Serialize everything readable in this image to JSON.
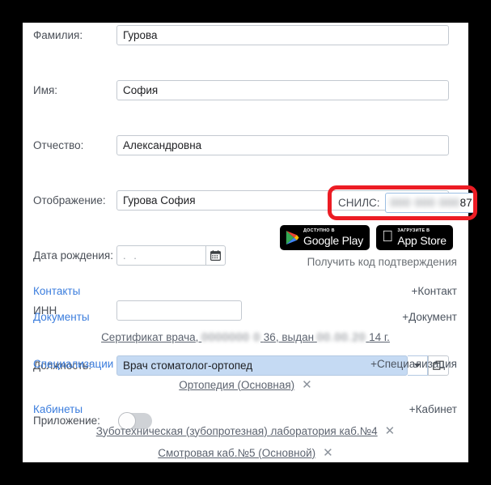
{
  "form": {
    "rows": [
      {
        "label": "Фамилия:",
        "value": "Гурова",
        "field": "wide"
      },
      {
        "label": "Имя:",
        "value": "София",
        "field": "wide"
      },
      {
        "label": "Отчество:",
        "value": "Александровна",
        "field": "wide"
      },
      {
        "label": "Отображение:",
        "value": "Гурова София",
        "field": "wide"
      },
      {
        "label": "Дата рождения:",
        "value": "",
        "field": "date"
      },
      {
        "label": "ИНН",
        "value": "",
        "field": "inn"
      },
      {
        "label": "Должность:",
        "value": "Врач стоматолог-ортопед",
        "field": "post"
      },
      {
        "label": "Приложение:",
        "value": "",
        "field": "toggle"
      }
    ],
    "help_label": "?",
    "date_placeholder": "__.__.____",
    "date_display": ". .",
    "toggle_state": "off",
    "calendar_icon": "calendar-icon",
    "dropdown_icon": "chevron-down-icon",
    "external_icon": "open-external-icon"
  },
  "snils": {
    "label": "СНИЛС:",
    "value_redacted": "000 000 000",
    "value_visible": "87",
    "highlight_color": "#ec1c24"
  },
  "stores": {
    "google": {
      "small": "ДОСТУПНО В",
      "big": "Google Play",
      "icon": "google-play-icon"
    },
    "apple": {
      "small": "Загрузите в",
      "big": "App Store",
      "icon": "apple-icon"
    }
  },
  "confirm_code_label": "Получить код подтверждения",
  "sections": [
    {
      "title": "Контакты",
      "add_label": "+Контакт",
      "items": []
    },
    {
      "title": "Документы",
      "add_label": "+Документ",
      "items": [
        {
          "prefix": "Сертификат врача,",
          "redacted_1": "0000000 0",
          "middle": "36, выдан",
          "redacted_2": "00.00.20",
          "suffix": "14 г.",
          "removable": false
        }
      ]
    },
    {
      "title": "Специализации",
      "add_label": "+Специализация",
      "items": [
        {
          "text": "Ортопедия (Основная)",
          "removable": true,
          "remove_icon": "close-icon"
        }
      ]
    },
    {
      "title": "Кабинеты",
      "add_label": "+Кабинет",
      "items": [
        {
          "text": "Зуботехническая (зубопротезная) лаборатория каб.№4",
          "removable": true,
          "remove_icon": "close-icon"
        },
        {
          "text": "Смотровая каб.№5 (Основной)",
          "removable": true,
          "remove_icon": "close-icon"
        }
      ]
    }
  ],
  "colors": {
    "link": "#3b7ddd",
    "label": "#4a4f57",
    "item_link": "#5d6470",
    "field_border": "#c3c9d0",
    "readonly_bg": "#c5daf3",
    "accent_red": "#ec1c24"
  }
}
